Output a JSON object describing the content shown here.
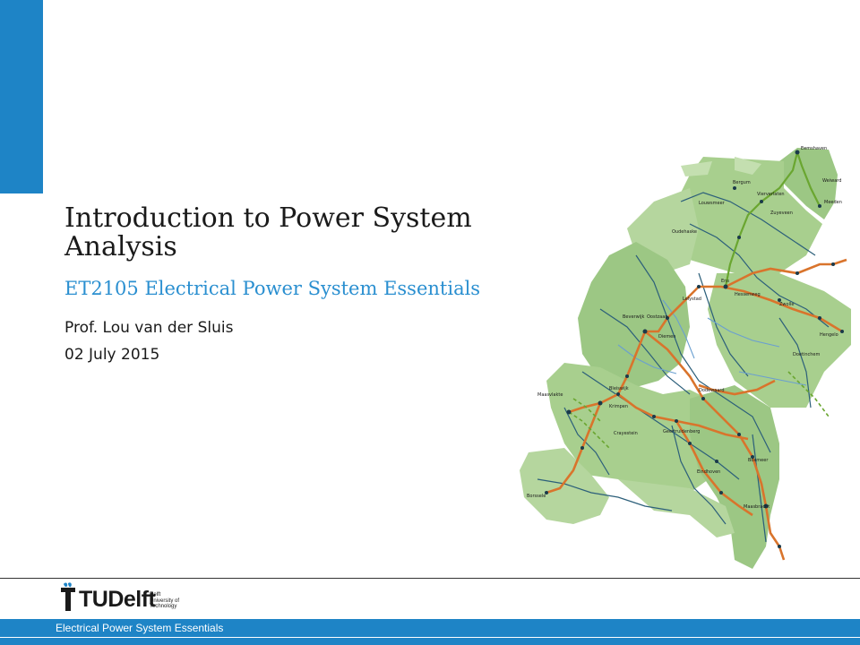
{
  "slide": {
    "title": "Introduction to Power System Analysis",
    "subtitle": "ET2105 Electrical Power System Essentials",
    "author": "Prof. Lou van der Sluis",
    "date": "02 July 2015"
  },
  "logo": {
    "wordmark": "TUDelft",
    "text_letters": "Delft",
    "tagline_lines": [
      "Delft",
      "University of",
      "Technology"
    ]
  },
  "footer": {
    "text": "Electrical Power System Essentials"
  },
  "map": {
    "place_labels": [
      "Eemshaven",
      "Weiward",
      "Bergum",
      "Vierverlaten",
      "Meeden",
      "Louwsmeer",
      "Zuyeveen",
      "Oudehaske",
      "Ens",
      "Lelystad",
      "Hessenweg",
      "Zwolle",
      "Beverwijk",
      "Oostzaan",
      "Diemen",
      "Hengelo",
      "Doetinchem",
      "Dodewaard",
      "Maasvlakte",
      "Bleiswijk",
      "Krimpen",
      "Crayestein",
      "Geertruidenberg",
      "Boxmeer",
      "Eindhoven",
      "Borssele",
      "Maasbracht"
    ],
    "colors": {
      "region_fill": "#a8cf8e",
      "region_fill_dark": "#8fbf74",
      "line_380kv": "#d9742c",
      "line_220kv": "#6aa630",
      "line_150kv": "#2c5f7a",
      "line_110kv": "#6a9fd0"
    }
  }
}
